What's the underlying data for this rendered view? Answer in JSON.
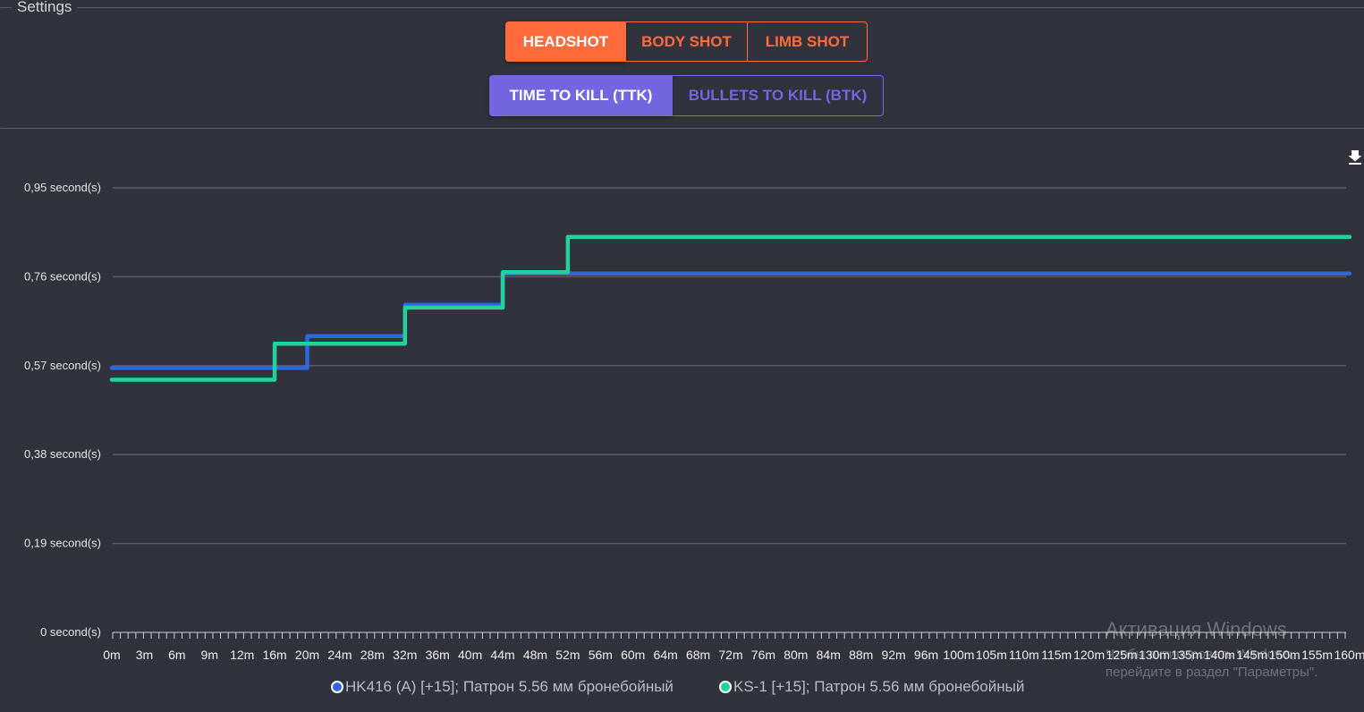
{
  "settings": {
    "legend": "Settings",
    "shot_buttons": [
      {
        "label": "HEADSHOT",
        "active": true
      },
      {
        "label": "BODY SHOT",
        "active": false
      },
      {
        "label": "LIMB SHOT",
        "active": false
      }
    ],
    "metric_buttons": [
      {
        "label": "TIME TO KILL (TTK)",
        "active": true
      },
      {
        "label": "BULLETS TO KILL (BTK)",
        "active": false
      }
    ]
  },
  "colors": {
    "accent_orange": "#ff6b3c",
    "accent_purple": "#7466e0",
    "series_hk416": "#2e66e0",
    "series_ks1": "#22d29c",
    "background": "#32323d",
    "gridline": "#5a5a64"
  },
  "toolbar": {
    "download_icon": "download-icon"
  },
  "chart_data": {
    "type": "line",
    "title": "",
    "xlabel": "",
    "ylabel": "",
    "y_ticks": [
      "0 second(s)",
      "0,19 second(s)",
      "0,38 second(s)",
      "0,57 second(s)",
      "0,76 second(s)",
      "0,95 second(s)"
    ],
    "y_tick_values": [
      0,
      0.19,
      0.38,
      0.57,
      0.76,
      0.95
    ],
    "ylim": [
      0,
      0.95
    ],
    "x_tick_labels": [
      "0m",
      "3m",
      "6m",
      "9m",
      "12m",
      "16m",
      "20m",
      "24m",
      "28m",
      "32m",
      "36m",
      "40m",
      "44m",
      "48m",
      "52m",
      "56m",
      "60m",
      "64m",
      "68m",
      "72m",
      "76m",
      "80m",
      "84m",
      "88m",
      "92m",
      "96m",
      "100m",
      "105m",
      "110m",
      "115m",
      "120m",
      "125m",
      "130m",
      "135m",
      "140m",
      "145m",
      "150m",
      "155m",
      "160m"
    ],
    "grid": true,
    "legend_position": "bottom",
    "series": [
      {
        "name": "HK416 (A) [+15]; Патрон 5.56 мм бронебойный",
        "points": [
          {
            "x": "0m",
            "y": 0.565
          },
          {
            "x": "20m",
            "y": 0.565
          },
          {
            "x": "20m",
            "y": 0.633
          },
          {
            "x": "32m",
            "y": 0.633
          },
          {
            "x": "32m",
            "y": 0.7
          },
          {
            "x": "44m",
            "y": 0.7
          },
          {
            "x": "44m",
            "y": 0.767
          },
          {
            "x": "56m",
            "y": 0.767
          },
          {
            "x": "160m",
            "y": 0.767
          }
        ]
      },
      {
        "name": "KS-1 [+15]; Патрон 5.56 мм бронебойный",
        "points": [
          {
            "x": "0m",
            "y": 0.54
          },
          {
            "x": "16m",
            "y": 0.54
          },
          {
            "x": "16m",
            "y": 0.617
          },
          {
            "x": "32m",
            "y": 0.617
          },
          {
            "x": "32m",
            "y": 0.694
          },
          {
            "x": "44m",
            "y": 0.694
          },
          {
            "x": "44m",
            "y": 0.77
          },
          {
            "x": "52m",
            "y": 0.77
          },
          {
            "x": "52m",
            "y": 0.845
          },
          {
            "x": "160m",
            "y": 0.845
          }
        ]
      }
    ]
  },
  "watermark": {
    "title": "Активация Windows",
    "subtitle": "Чтобы активировать Windows, перейдите в раздел \"Параметры\"."
  }
}
